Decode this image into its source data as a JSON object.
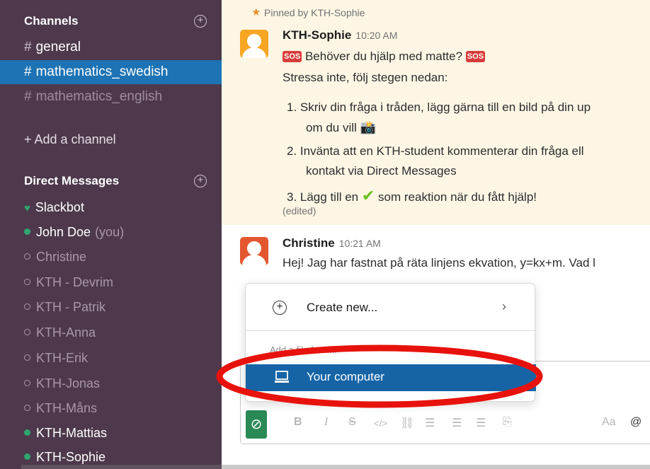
{
  "sidebar": {
    "channels_heading": "Channels",
    "channels": [
      {
        "name": "general"
      },
      {
        "name": "mathematics_swedish"
      },
      {
        "name": "mathematics_english"
      }
    ],
    "add_channel": "+ Add a channel",
    "dm_heading": "Direct Messages",
    "dms": [
      {
        "name": "Slackbot"
      },
      {
        "name": "John Doe",
        "suffix": "(you)"
      },
      {
        "name": "Christine"
      },
      {
        "name": "KTH - Devrim"
      },
      {
        "name": "KTH - Patrik"
      },
      {
        "name": "KTH-Anna"
      },
      {
        "name": "KTH-Erik"
      },
      {
        "name": "KTH-Jonas"
      },
      {
        "name": "KTH-Måns"
      },
      {
        "name": "KTH-Mattias"
      },
      {
        "name": "KTH-Sophie"
      }
    ],
    "colors": {
      "background": "#4d394b",
      "active": "#1d73b4",
      "online": "#2fa66f"
    }
  },
  "main": {
    "pinned_label": "Pinned by KTH-Sophie",
    "msg1": {
      "author": "KTH-Sophie",
      "time": "10:20 AM",
      "line1": "Behöver du hjälp med matte?",
      "line2": "Stressa inte, följ stegen nedan:",
      "step1a": "1.  Skriv din fråga i tråden, lägg gärna till en bild på din up",
      "step1b": "om du vill",
      "step2a": "2.  Invänta att en KTH-student kommenterar din fråga ell",
      "step2b": "kontakt via Direct Messages",
      "step3a": "3.  Lägg till en",
      "step3b": "som reaktion när du fått hjälp!",
      "edited": "(edited)"
    },
    "msg2": {
      "author": "Christine",
      "time": "10:21 AM",
      "line1": "Hej! Jag har fastnat på räta linjens ekvation, y=kx+m. Vad l"
    },
    "sos_badge": "SOS"
  },
  "popup": {
    "create_new": "Create new...",
    "add_from": "Add a file from...",
    "your_computer": "Your computer"
  },
  "composer": {
    "format_aa": "Aa",
    "at": "@"
  }
}
